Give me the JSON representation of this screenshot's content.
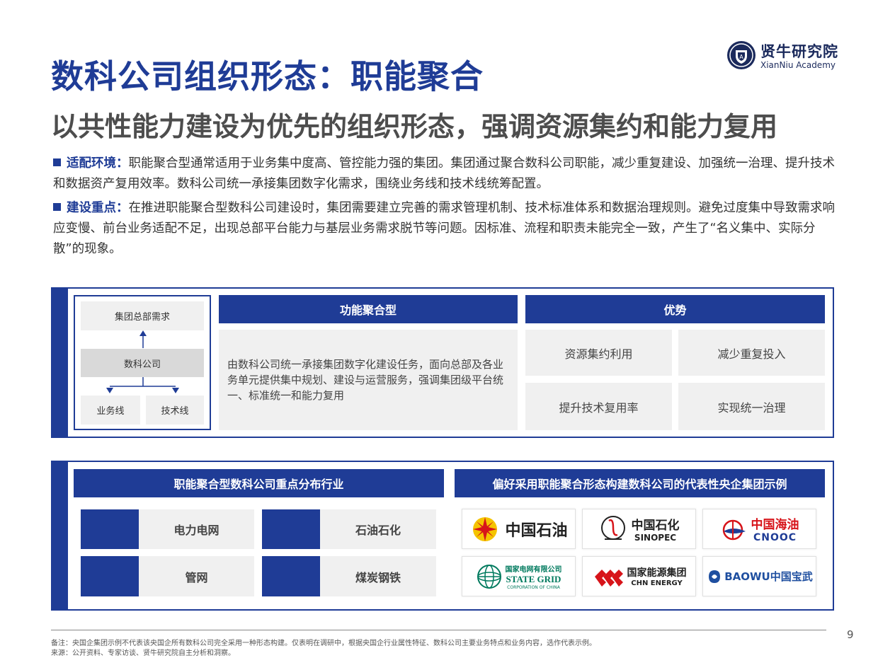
{
  "logo": {
    "name_cn": "贤牛研究院",
    "name_en": "XianNiu Academy"
  },
  "title": "数科公司组织形态：职能聚合",
  "subtitle": "以共性能力建设为优先的组织形态，强调资源集约和能力复用",
  "bullets": [
    {
      "keyword": "适配环境：",
      "text": "职能聚合型通常适用于业务集中度高、管控能力强的集团。集团通过聚合数科公司职能，减少重复建设、加强统一治理、提升技术和数据资产复用效率。数科公司统一承接集团数字化需求，围绕业务线和技术线统筹配置。"
    },
    {
      "keyword": "建设重点：",
      "text": "在推进职能聚合型数科公司建设时，集团需要建立完善的需求管理机制、技术标准体系和数据治理规则。避免过度集中导致需求响应变慢、前台业务适配不足，出现总部平台能力与基层业务需求脱节等问题。因标准、流程和职责未能完全一致，产生了“名义集中、实际分散”的现象。"
    }
  ],
  "diagram": {
    "top": "集团总部需求",
    "middle": "数科公司",
    "left": "业务线",
    "right": "技术线"
  },
  "function_panel": {
    "header": "功能聚合型",
    "description": "由数科公司统一承接集团数字化建设任务，面向总部及各业务单元提供集中规划、建设与运营服务，强调集团级平台统一、标准统一和能力复用"
  },
  "advantage_panel": {
    "header": "优势",
    "items": [
      "资源集约利用",
      "减少重复投入",
      "提升技术复用率",
      "实现统一治理"
    ]
  },
  "industry_panel": {
    "header": "职能聚合型数科公司重点分布行业",
    "items": [
      "电力电网",
      "石油石化",
      "管网",
      "煤炭钢铁"
    ]
  },
  "examples_panel": {
    "header": "偏好采用职能聚合形态构建数科公司的代表性央企集团示例",
    "logos": [
      {
        "name": "中国石油",
        "icon": "cnpc-logo",
        "color": "#d7141a"
      },
      {
        "name_cn": "中国石化",
        "name_en": "SINOPEC",
        "icon": "sinopec-logo"
      },
      {
        "name_cn": "中国海油",
        "name_en": "CNOOC",
        "icon": "cnooc-logo",
        "color": "#d7141a"
      },
      {
        "name_cn": "国家电网有限公司",
        "name_en": "STATE GRID",
        "name_sub": "CORPORATION OF CHINA",
        "icon": "state-grid-logo",
        "color": "#007a5e"
      },
      {
        "name_cn": "国家能源集团",
        "name_en": "CHN ENERGY",
        "icon": "chn-energy-logo",
        "color": "#d7141a"
      },
      {
        "name_en": "BAOWU",
        "name_cn": "中国宝武",
        "icon": "baowu-logo",
        "color": "#1f4fa0"
      }
    ]
  },
  "footer": {
    "note": "备注：央国企集团示例不代表该央国企所有数科公司完全采用一种形态构建。仅表明在调研中，根据央国企行业属性特征、数科公司主要业务特点和业务内容，选作代表示例。",
    "source": "来源：公开资料、专家访谈、贤牛研究院自主分析和洞察。",
    "page": "9"
  }
}
